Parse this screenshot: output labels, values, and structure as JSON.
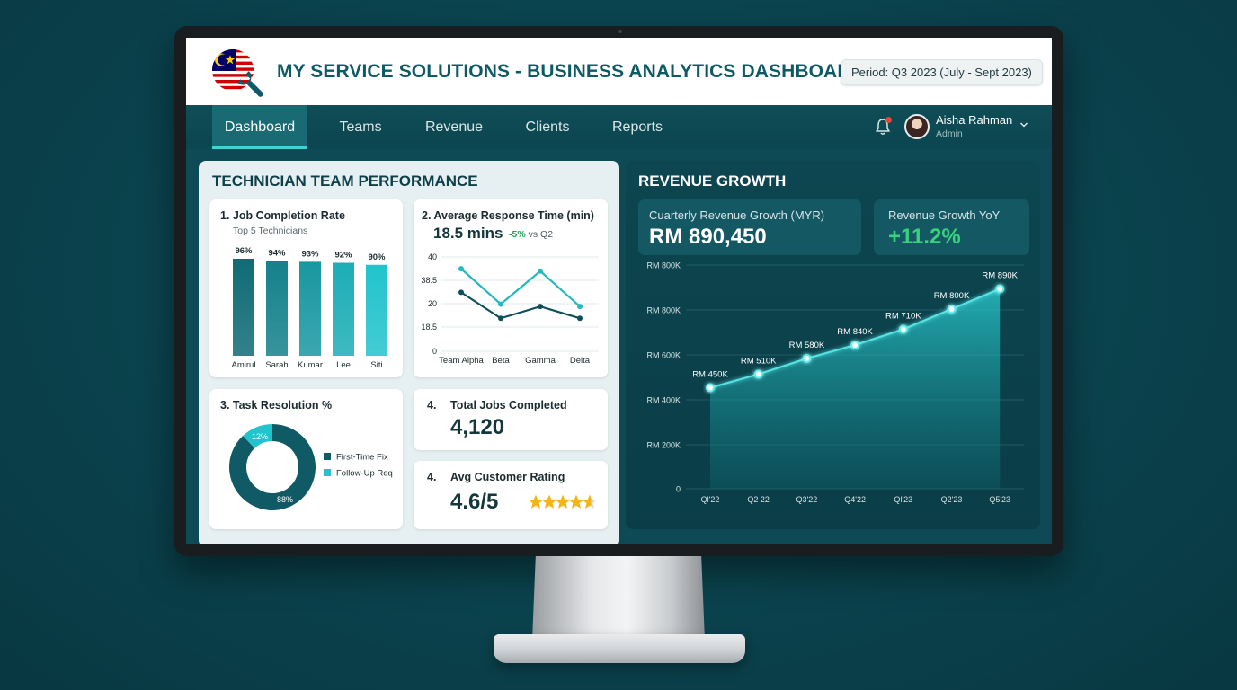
{
  "header": {
    "title": "MY SERVICE SOLUTIONS - BUSINESS ANALYTICS DASHBOARD",
    "period": "Period: Q3 2023 (July - Sept 2023)",
    "logo_icon": "malaysia-flag-wrench-icon"
  },
  "nav": {
    "tabs": [
      {
        "label": "Dashboard",
        "active": true
      },
      {
        "label": "Teams",
        "active": false
      },
      {
        "label": "Revenue",
        "active": false
      },
      {
        "label": "Clients",
        "active": false
      },
      {
        "label": "Reports",
        "active": false
      }
    ],
    "notification_icon": "bell-icon",
    "user": {
      "name": "Aisha Rahman",
      "role": "Admin"
    }
  },
  "technician_panel": {
    "title": "TECHNICIAN TEAM PERFORMANCE",
    "job_completion": {
      "title": "1.  Job Completion Rate",
      "subtitle": "Top 5 Technicians"
    },
    "response_time": {
      "title": "2. Average Response Time (min)",
      "value": "18.5 mins",
      "delta": "-5%",
      "delta_suffix": "vs Q2"
    },
    "task_resolution": {
      "title": "3. Task Resolution %"
    },
    "total_jobs": {
      "number": "4.",
      "title": "Total Jobs Completed",
      "value": "4,120"
    },
    "rating": {
      "number": "4.",
      "title": "Avg Customer Rating",
      "value": "4.6/5",
      "stars": 4.6
    }
  },
  "revenue_panel": {
    "title": "REVENUE GROWTH",
    "quarterly": {
      "label": "Cuarterly Revenue Growth (MYR)",
      "value": "RM 890,450"
    },
    "yoy": {
      "label": "Revenue Growth YoY",
      "value": "+11.2%"
    }
  },
  "colors": {
    "brand_teal": "#0d5a66",
    "bar_dark": "#0f6b75",
    "bar_light": "#22c3cc",
    "accent_cyan": "#3fd3d5",
    "positive_green": "#39d17c",
    "star_gold": "#f4b41a"
  },
  "chart_data": [
    {
      "type": "bar",
      "title": "Job Completion Rate",
      "categories": [
        "Amirul",
        "Sarah",
        "Kumar",
        "Lee",
        "Siti"
      ],
      "values": [
        96,
        94,
        93,
        92,
        90
      ],
      "labels": [
        "96%",
        "94%",
        "93%",
        "92%",
        "90%"
      ],
      "ylim": [
        0,
        100
      ]
    },
    {
      "type": "line",
      "title": "Average Response Time (min)",
      "categories": [
        "Team Alpha",
        "Beta",
        "Gamma",
        "Delta"
      ],
      "yticks": [
        "40",
        "38.5",
        "20",
        "18.5",
        "0"
      ],
      "ylim": [
        0,
        40
      ],
      "series": [
        {
          "values": [
            35,
            20,
            34,
            19
          ],
          "color": "#26b9c0"
        },
        {
          "values": [
            25,
            14,
            19,
            14
          ],
          "color": "#0f4f59"
        }
      ]
    },
    {
      "type": "pie",
      "title": "Task Resolution %",
      "donut": true,
      "slices": [
        {
          "name": "First-Time Fix",
          "value": 88,
          "label": "88%",
          "color": "#0f5a64"
        },
        {
          "name": "Follow-Up Req",
          "value": 12,
          "label": "12%",
          "color": "#22c3cc"
        }
      ]
    },
    {
      "type": "area",
      "title": "Revenue Growth",
      "categories": [
        "Ql'22",
        "Q2 22",
        "Q3'22",
        "Q4'22",
        "Ql'23",
        "Q2'23",
        "Q5'23"
      ],
      "values": [
        450,
        510,
        580,
        640,
        710,
        800,
        890
      ],
      "labels": [
        "RM 450K",
        "RM 510K",
        "RM 580K",
        "RM 840K",
        "RM 710K",
        "RM 800K",
        "RM 890K"
      ],
      "yticks": [
        "RM 800K",
        "RM 800K",
        "RM 600K",
        "RM 400K",
        "RM 200K",
        "0"
      ],
      "ylim": [
        0,
        1000
      ],
      "grid": true
    }
  ]
}
